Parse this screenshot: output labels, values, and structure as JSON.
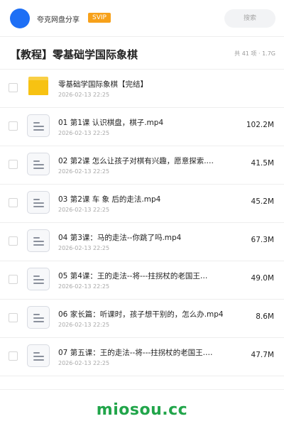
{
  "header": {
    "username": "夸克网盘分享",
    "badge": "SVIP",
    "search_placeholder": "搜索"
  },
  "title": "【教程】零基础学国际象棋",
  "summary": "共 41 项 · 1.7G",
  "items": [
    {
      "type": "folder",
      "name": "零基础学国际象棋【完结】",
      "date": "2026-02-13 22:25",
      "size": ""
    },
    {
      "type": "file",
      "name": "01 第1课 认识棋盘，棋子.mp4",
      "date": "2026-02-13 22:25",
      "size": "102.2M"
    },
    {
      "type": "file",
      "name": "02 第2课 怎么让孩子对棋有兴趣，愿意探索.…",
      "date": "2026-02-13 22:25",
      "size": "41.5M"
    },
    {
      "type": "file",
      "name": "03 第2课 车 象 后的走法.mp4",
      "date": "2026-02-13 22:25",
      "size": "45.2M"
    },
    {
      "type": "file",
      "name": "04 第3课：马的走法--你跳了吗.mp4",
      "date": "2026-02-13 22:25",
      "size": "67.3M"
    },
    {
      "type": "file",
      "name": "05 第4课：王的走法--将---拄拐杖的老国王…",
      "date": "2026-02-13 22:25",
      "size": "49.0M"
    },
    {
      "type": "file",
      "name": "06 家长篇：听课时，孩子想干别的，怎么办.mp4",
      "date": "2026-02-13 22:25",
      "size": "8.6M"
    },
    {
      "type": "file",
      "name": "07 第五课：王的走法--将---拄拐杖的老国王.…",
      "date": "2026-02-13 22:25",
      "size": "47.7M"
    }
  ],
  "watermark": "miosou.cc",
  "colors": {
    "accent": "#1e6ff5",
    "badge": "#f7a11a",
    "folder": "#f7c212",
    "watermark": "#21a54a"
  }
}
